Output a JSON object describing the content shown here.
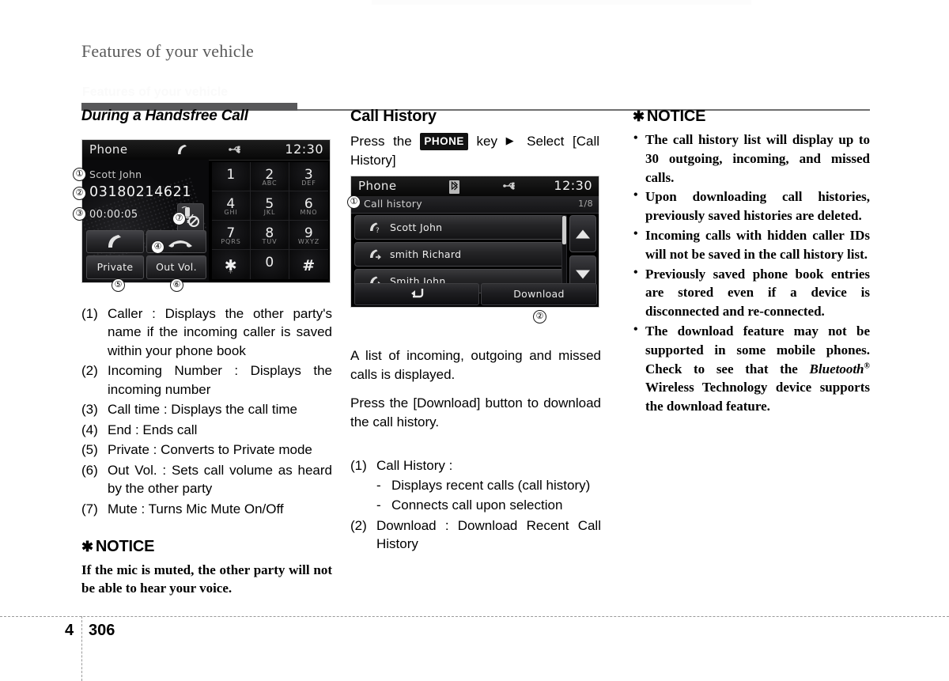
{
  "header": {
    "title": "Features of your vehicle",
    "ghost_line": "Features of your vehicle"
  },
  "footer": {
    "chapter": "4",
    "page": "306"
  },
  "left_column": {
    "section_title": "During a Handsfree Call",
    "items": [
      {
        "num": "(1)",
        "text": "Caller : Displays the other party's name if the incoming caller is saved within your phone book"
      },
      {
        "num": "(2)",
        "text": "Incoming Number : Displays the incoming number"
      },
      {
        "num": "(3)",
        "text": "Call time : Displays the call time"
      },
      {
        "num": "(4)",
        "text": "End : Ends call"
      },
      {
        "num": "(5)",
        "text": "Private : Converts to Private mode"
      },
      {
        "num": "(6)",
        "text": "Out Vol. : Sets call volume as heard by the other party"
      },
      {
        "num": "(7)",
        "text": "Mute : Turns Mic Mute On/Off"
      }
    ],
    "notice": {
      "star": "✱",
      "heading": "NOTICE",
      "body": "If the mic is muted, the other party will not be able to hear your voice."
    }
  },
  "call_screen": {
    "status": {
      "title": "Phone",
      "clock": "12:30",
      "icons": [
        "call-handset-icon",
        "usb-icon"
      ]
    },
    "caller_name": "Scott John",
    "caller_number": "03180214621",
    "call_time": "00:00:05",
    "mute_icon": "mic-mute-icon",
    "answer_icon": "call-answer-icon",
    "end_icon": "call-end-icon",
    "buttons": {
      "private": "Private",
      "out_vol": "Out Vol."
    },
    "keypad": [
      {
        "digit": "1",
        "letters": ""
      },
      {
        "digit": "2",
        "letters": "ABC"
      },
      {
        "digit": "3",
        "letters": "DEF"
      },
      {
        "digit": "4",
        "letters": "GHI"
      },
      {
        "digit": "5",
        "letters": "JKL"
      },
      {
        "digit": "6",
        "letters": "MNO"
      },
      {
        "digit": "7",
        "letters": "PQRS"
      },
      {
        "digit": "8",
        "letters": "TUV"
      },
      {
        "digit": "9",
        "letters": "WXYZ"
      },
      {
        "digit": "✱",
        "letters": "+"
      },
      {
        "digit": "0",
        "letters": ""
      },
      {
        "digit": "#",
        "letters": ""
      }
    ],
    "callouts": {
      "c1": "①",
      "c2": "②",
      "c3": "③",
      "c4": "④",
      "c5": "⑤",
      "c6": "⑥",
      "c7": "⑦"
    }
  },
  "mid_column": {
    "section_title": "Call History",
    "intro_pre": "Press the ",
    "intro_key": "PHONE",
    "intro_mid": " key ",
    "intro_arrow": "▶",
    "intro_post": " Select [Call History]",
    "para1": "A list of incoming, outgoing and missed calls is displayed.",
    "para2": "Press the [Download] button to download the call history.",
    "items": [
      {
        "num": "(1)",
        "text": "Call History :",
        "sub": false
      },
      {
        "num": "-",
        "text": "Displays recent calls (call history)",
        "sub": true
      },
      {
        "num": "-",
        "text": "Connects call upon selection",
        "sub": true
      },
      {
        "num": "(2)",
        "text": "Download : Download Recent Call History",
        "sub": false
      }
    ]
  },
  "history_screen": {
    "status": {
      "title": "Phone",
      "clock": "12:30",
      "icons": [
        "bluetooth-icon",
        "usb-icon"
      ]
    },
    "subheader_label": "Call history",
    "page_indicator": "1/8",
    "rows": [
      {
        "name": "Scott John",
        "icon": "call-missed-icon"
      },
      {
        "name": "smith Richard",
        "icon": "call-outgoing-icon"
      },
      {
        "name": "Smith John",
        "icon": "call-outgoing-icon"
      }
    ],
    "back_icon": "back-arrow-icon",
    "download_label": "Download",
    "scroll_up_icon": "chevron-up-icon",
    "scroll_down_icon": "chevron-down-icon",
    "callouts": {
      "c1": "①",
      "c2": "②"
    }
  },
  "right_column": {
    "notice": {
      "star": "✱",
      "heading": "NOTICE",
      "bullets": [
        "The call history list will display up to 30 outgoing, incoming, and missed calls.",
        "Upon downloading call histories, previously saved histories are deleted.",
        "Incoming calls with hidden caller IDs will not be saved in the call history list.",
        "Previously saved phone book entries are stored even if a device is disconnected and re-connected."
      ],
      "bullet_last_a": "The download feature may not be supported in some mobile phones. Check to see that the ",
      "bullet_last_bt": "Bluetooth",
      "bullet_last_reg": "®",
      "bullet_last_b": " Wireless Technology device supports the download feature."
    }
  }
}
